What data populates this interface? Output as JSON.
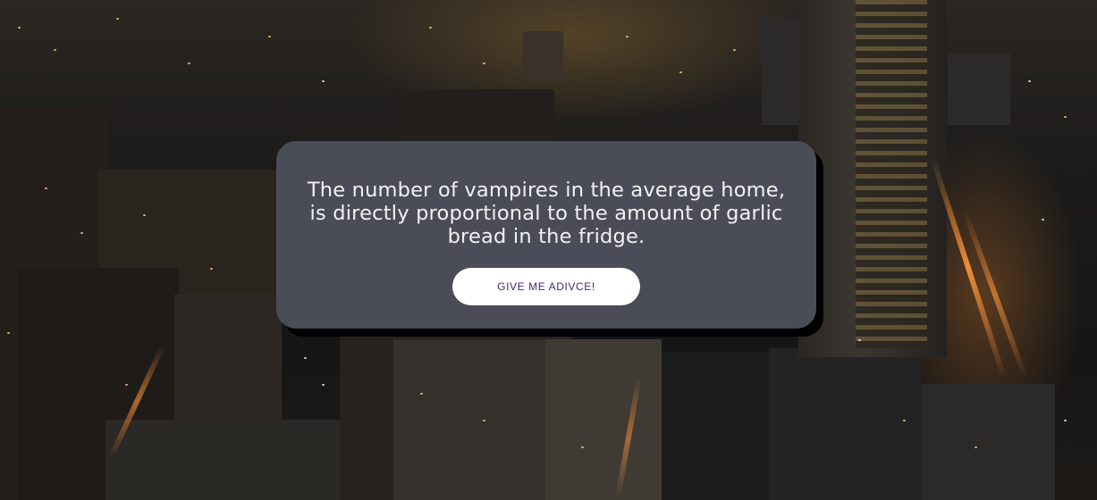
{
  "background": {
    "description_icon": "city-night-skyline-image"
  },
  "card": {
    "quote": "The number of vampires in the average home, is directly proportional to the amount of garlic bread in the fridge.",
    "button_label": "GIVE ME ADIVCE!"
  },
  "colors": {
    "card_background": "#4a4d57",
    "card_text": "#f1f2f4",
    "button_background": "#ffffff",
    "button_text": "#3f2a6f"
  }
}
